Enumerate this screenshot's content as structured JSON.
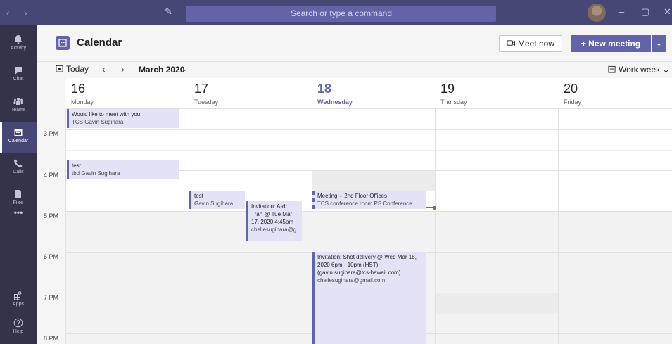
{
  "titlebar": {
    "search_placeholder": "Search or type a command",
    "back_glyph": "‹",
    "forward_glyph": "›",
    "compose_glyph": "✎",
    "minimize_glyph": "–",
    "maximize_glyph": "▢",
    "close_glyph": "✕",
    "color": "#464775"
  },
  "rail": {
    "items": [
      {
        "label": "Activity",
        "icon": "bell-icon"
      },
      {
        "label": "Chat",
        "icon": "chat-icon"
      },
      {
        "label": "Teams",
        "icon": "teams-icon"
      },
      {
        "label": "Calendar",
        "icon": "calendar-icon",
        "active": true
      },
      {
        "label": "Calls",
        "icon": "phone-icon"
      },
      {
        "label": "Files",
        "icon": "file-icon"
      },
      {
        "label": "•••",
        "icon": "more-icon"
      },
      {
        "label": "Apps",
        "icon": "apps-icon"
      },
      {
        "label": "Help",
        "icon": "help-icon"
      }
    ]
  },
  "header": {
    "title": "Calendar",
    "meet_now": "Meet now",
    "new_meeting": "+ New meeting",
    "new_meeting_dropdown": "⌄",
    "accent": "#6264a7"
  },
  "toolbar": {
    "today": "Today",
    "prev": "‹",
    "next": "›",
    "month": "March 2020",
    "month_dropdown": "⌄",
    "view": "Work week ⌄"
  },
  "days": [
    {
      "num": "16",
      "name": "Monday"
    },
    {
      "num": "17",
      "name": "Tuesday"
    },
    {
      "num": "18",
      "name": "Wednesday",
      "today": true
    },
    {
      "num": "19",
      "name": "Thursday"
    },
    {
      "num": "20",
      "name": "Friday"
    }
  ],
  "hours": [
    "3 PM",
    "4 PM",
    "5 PM",
    "6 PM",
    "7 PM",
    "8 PM"
  ],
  "events": {
    "e1_title": "Would like to meet with you",
    "e1_sub": "TCS  Gavin Sugihara",
    "e2_title": "test",
    "e2_sub": "tbd  Gavin Sugihara",
    "e3_title": "test",
    "e3_sub": "Gavin Sugihara",
    "e4_title": "Invitation: A-dr Tran @ Tue Mar 17, 2020 4:45pm",
    "e4_sub": "chellesugihara@g",
    "e5_title": "Meeting -- 2nd Floor Offices",
    "e5_sub": "TCS conference room  PS Conference",
    "e6_title": "Invitation: Shot delivery @ Wed Mar 18, 2020 6pm - 10pm (HST) (gavin.sugihara@tcs-hawaii.com)",
    "e6_sub": "chellesugihara@gmail.com"
  }
}
